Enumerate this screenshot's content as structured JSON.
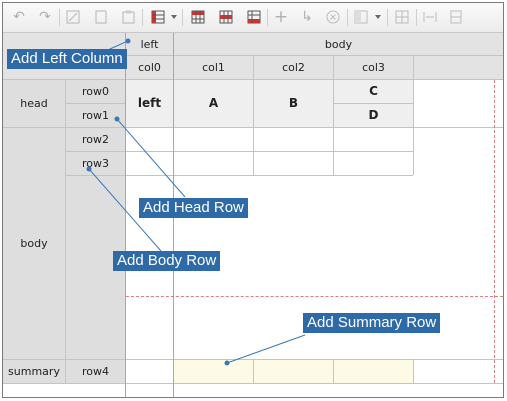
{
  "toolbar": {
    "icons": [
      "undo-icon",
      "redo-icon",
      "cut-icon",
      "copy-icon",
      "paste-icon",
      "table-layout-icon",
      "add-head-row-icon",
      "add-body-row-icon",
      "add-summary-row-icon",
      "add-icon",
      "redirect-icon",
      "remove-icon",
      "align-icon",
      "grid-icon",
      "merge-icon",
      "split-icon"
    ]
  },
  "grid": {
    "groups": {
      "left": "left",
      "body": "body"
    },
    "columns": {
      "col0": "col0",
      "col1": "col1",
      "col2": "col2",
      "col3": "col3"
    },
    "sections": {
      "head": "head",
      "body": "body",
      "summary": "summary"
    },
    "rows": {
      "row0": "row0",
      "row1": "row1",
      "row2": "row2",
      "row3": "row3",
      "row4": "row4"
    },
    "cells": {
      "left": "left",
      "A": "A",
      "B": "B",
      "C": "C",
      "D": "D"
    }
  },
  "callouts": {
    "add_left_column": "Add Left Column",
    "add_head_row": "Add Head Row",
    "add_body_row": "Add Body Row",
    "add_summary_row": "Add Summary Row"
  },
  "colors": {
    "header_gray": "#e3e3e3",
    "summary_yellow": "#fdfbe6",
    "callout_blue": "#2e6aa8",
    "dashed_red": "#d98080"
  }
}
